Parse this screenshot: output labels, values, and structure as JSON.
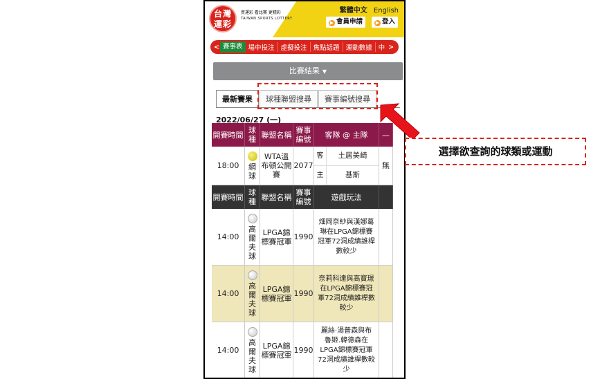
{
  "header": {
    "logo_line1": "台灣",
    "logo_line2": "運彩",
    "brand_games": "買運彩 看比賽 更精彩",
    "brand_en": "TAIWAN SPORTS LOTTERY",
    "lang_zh": "繁體中文",
    "lang_en": "English",
    "member_label": "會員申請",
    "login_label": "登入"
  },
  "nav": {
    "prev": "<",
    "next": ">",
    "tabs": [
      "賽事表",
      "場中投注",
      "虛擬投注",
      "焦點話題",
      "運動數據",
      "中"
    ]
  },
  "filter": {
    "label": "比賽結果",
    "caret": "▼"
  },
  "search_tabs": [
    "最新賽果",
    "球種聯盟搜尋",
    "賽事編號搜尋"
  ],
  "date": "2022/06/27 (一)",
  "table1": {
    "headers": [
      "開賽時間",
      "球種",
      "聯盟名稱",
      "賽事編號",
      "客隊 @ 主隊",
      "—"
    ],
    "row": {
      "time": "18:00",
      "sport": "網球",
      "league": "WTA溫布頓公開賽",
      "code": "2077",
      "away_tag": "客",
      "away": "土居美崎",
      "home_tag": "主",
      "home": "基斯",
      "extra": "無"
    }
  },
  "table2": {
    "headers": [
      "開賽時間",
      "球種",
      "聯盟名稱",
      "賽事編號",
      "遊戲玩法",
      ""
    ],
    "rows": [
      {
        "time": "14:00",
        "sport": "高爾夫球",
        "league": "LPGA錦標賽冠軍",
        "code": "1990",
        "play": "畑岡奈紗與漢娜葛琳在LPGA錦標賽冠軍72洞成績誰桿數較少"
      },
      {
        "time": "14:00",
        "sport": "高爾夫球",
        "league": "LPGA錦標賽冠軍",
        "code": "1990",
        "play": "奈莉科達與高寶璟在LPGA錦標賽冠軍72洞成績誰桿數較少"
      },
      {
        "time": "14:00",
        "sport": "高爾夫球",
        "league": "LPGA錦標賽冠軍",
        "code": "1990",
        "play": "麗絲·湯普森與布魯姬.韓德森在LPGA錦標賽冠軍72洞成績誰桿數較少"
      }
    ]
  },
  "annotation": {
    "callout": "選擇欲查詢的球類或運動",
    "color": "#d9241c"
  }
}
